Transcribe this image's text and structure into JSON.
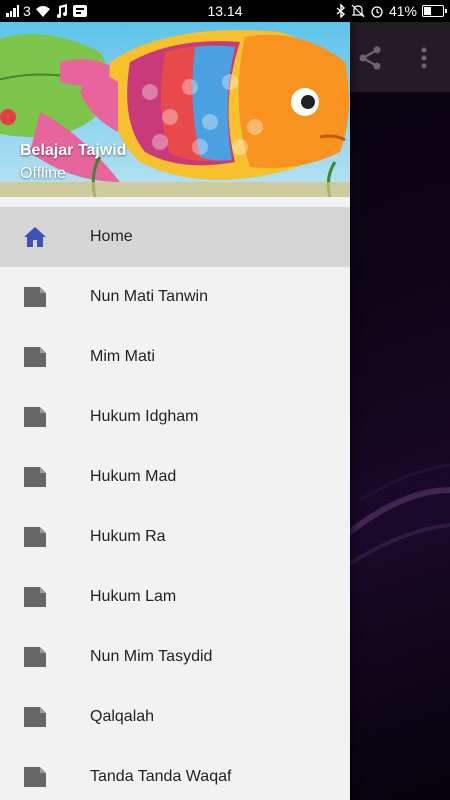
{
  "status_bar": {
    "carrier_signal": "3",
    "time": "13.14",
    "battery_percent": "41%",
    "battery_level": 0.41
  },
  "drawer": {
    "title": "Belajar Tajwid",
    "subtitle": "Offline",
    "items": [
      {
        "label": "Home",
        "icon": "home-icon",
        "active": true
      },
      {
        "label": "Nun Mati Tanwin",
        "icon": "page-icon"
      },
      {
        "label": "Mim Mati",
        "icon": "page-icon"
      },
      {
        "label": "Hukum Idgham",
        "icon": "page-icon"
      },
      {
        "label": "Hukum Mad",
        "icon": "page-icon"
      },
      {
        "label": "Hukum Ra",
        "icon": "page-icon"
      },
      {
        "label": "Hukum Lam",
        "icon": "page-icon"
      },
      {
        "label": "Nun Mim Tasydid",
        "icon": "page-icon"
      },
      {
        "label": "Qalqalah",
        "icon": "page-icon"
      },
      {
        "label": "Tanda Tanda Waqaf",
        "icon": "page-icon"
      }
    ]
  },
  "colors": {
    "accent": "#3f51b5",
    "active_row": "#d6d6d6",
    "icon_grey": "#666666"
  }
}
